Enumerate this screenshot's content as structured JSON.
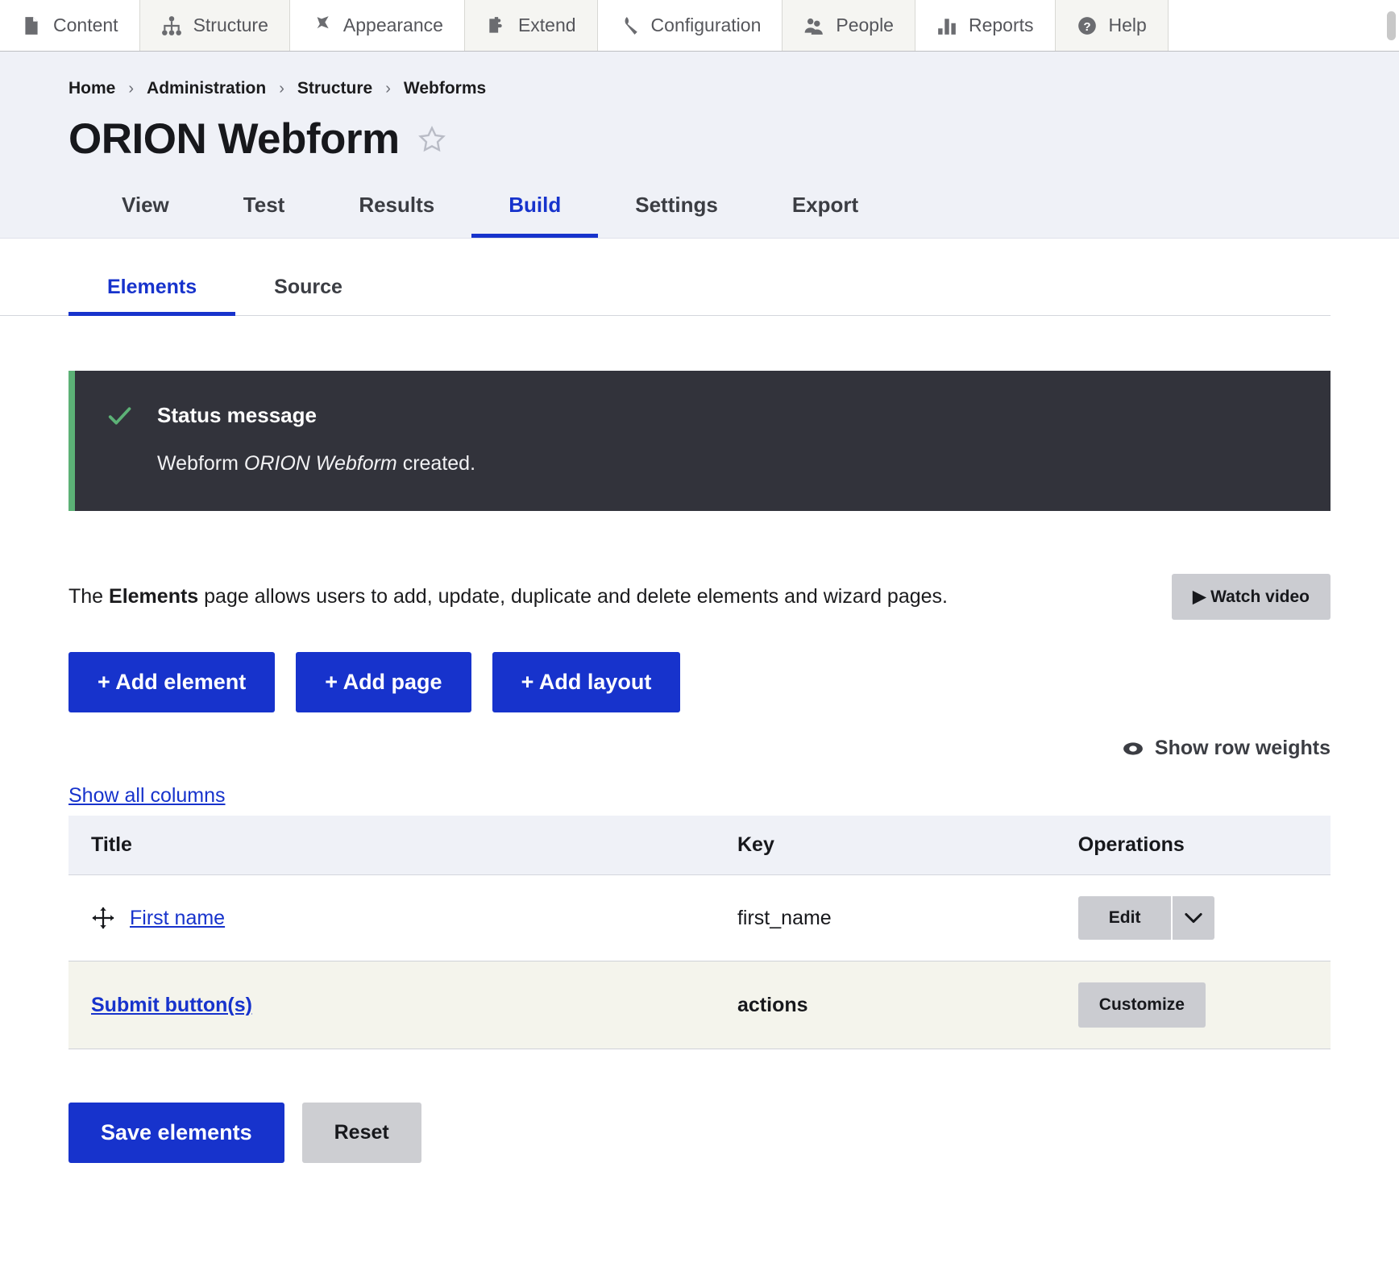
{
  "toolbar": {
    "items": [
      {
        "label": "Content",
        "icon": "document-icon",
        "shade": "alt"
      },
      {
        "label": "Structure",
        "icon": "sitemap-icon",
        "shade": "normal"
      },
      {
        "label": "Appearance",
        "icon": "paintbrush-icon",
        "shade": "alt"
      },
      {
        "label": "Extend",
        "icon": "puzzle-icon",
        "shade": "normal"
      },
      {
        "label": "Configuration",
        "icon": "wrench-icon",
        "shade": "alt"
      },
      {
        "label": "People",
        "icon": "people-icon",
        "shade": "normal"
      },
      {
        "label": "Reports",
        "icon": "bar-chart-icon",
        "shade": "alt"
      },
      {
        "label": "Help",
        "icon": "question-mark-icon",
        "shade": "normal"
      }
    ]
  },
  "breadcrumb": {
    "separator": "›",
    "items": [
      "Home",
      "Administration",
      "Structure",
      "Webforms"
    ]
  },
  "header": {
    "title": "ORION Webform",
    "star_icon": "star-outline-icon"
  },
  "primary_tabs": {
    "active": "Build",
    "items": [
      "View",
      "Test",
      "Results",
      "Build",
      "Settings",
      "Export"
    ]
  },
  "secondary_tabs": {
    "active": "Elements",
    "items": [
      "Elements",
      "Source"
    ]
  },
  "status_message": {
    "icon": "check-icon",
    "title": "Status message",
    "text_before": "Webform ",
    "text_emphasis": "ORION Webform",
    "text_after": " created.",
    "accent_color": "#5cb176",
    "background_color": "#32333b"
  },
  "description": {
    "part1": "The ",
    "bold": "Elements",
    "part2": " page allows users to add, update, duplicate and delete elements and wizard pages.",
    "watch_video_label": "▶ Watch video"
  },
  "actions": {
    "add_element": "+ Add element",
    "add_page": "+ Add page",
    "add_layout": "+ Add layout",
    "show_row_weights": "Show row weights",
    "show_row_weights_icon": "eye-icon"
  },
  "table": {
    "show_all_columns": "Show all columns",
    "columns": [
      "Title",
      "Key",
      "Operations"
    ],
    "rows": [
      {
        "drag_icon": "move-handle-icon",
        "title": "First name",
        "key": "first_name",
        "op_label": "Edit",
        "op_type": "dropbutton",
        "op_toggle_icon": "chevron-down-icon",
        "bold": false
      },
      {
        "drag_icon": "",
        "title": "Submit button(s)",
        "key": "actions",
        "op_label": "Customize",
        "op_type": "button",
        "op_toggle_icon": "",
        "bold": true
      }
    ]
  },
  "footer": {
    "save_label": "Save elements",
    "reset_label": "Reset"
  },
  "colors": {
    "primary_blue": "#1733cc",
    "grey_button": "#cbccd1",
    "header_bg": "#eff1f7",
    "status_green": "#5cb176"
  }
}
